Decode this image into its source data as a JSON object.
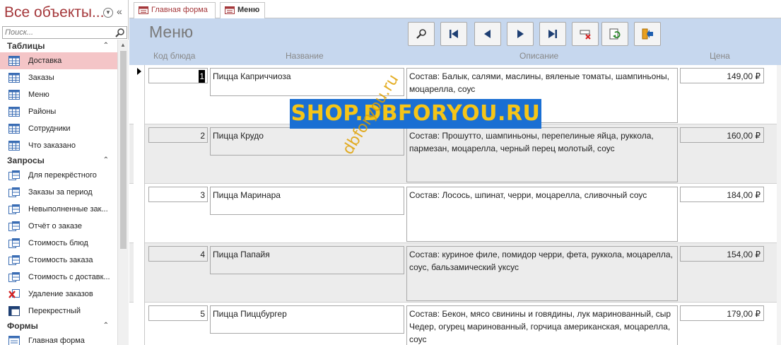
{
  "nav": {
    "title": "Все объекты...",
    "search_placeholder": "Поиск...",
    "groups": [
      {
        "label": "Таблицы",
        "items": [
          {
            "label": "Доставка",
            "icon": "table-icon",
            "selected": true
          },
          {
            "label": "Заказы",
            "icon": "table-icon"
          },
          {
            "label": "Меню",
            "icon": "table-icon"
          },
          {
            "label": "Районы",
            "icon": "table-icon"
          },
          {
            "label": "Сотрудники",
            "icon": "table-icon"
          },
          {
            "label": "Что заказано",
            "icon": "table-icon"
          }
        ]
      },
      {
        "label": "Запросы",
        "items": [
          {
            "label": "Для перекрёстного",
            "icon": "query-icon"
          },
          {
            "label": "Заказы за период",
            "icon": "query-icon"
          },
          {
            "label": "Невыполненные зак...",
            "icon": "query-icon"
          },
          {
            "label": "Отчёт о заказе",
            "icon": "query-icon"
          },
          {
            "label": "Стоимость блюд",
            "icon": "query-icon"
          },
          {
            "label": "Стоимость заказа",
            "icon": "query-icon"
          },
          {
            "label": "Стоимость с доставк...",
            "icon": "query-icon"
          },
          {
            "label": "Удаление заказов",
            "icon": "delete-query-icon"
          },
          {
            "label": "Перекрестный",
            "icon": "crosstab-query-icon"
          }
        ]
      },
      {
        "label": "Формы",
        "items": [
          {
            "label": "Главная форма",
            "icon": "form-icon"
          }
        ]
      }
    ]
  },
  "tabs": [
    {
      "label": "Главная форма",
      "active": false
    },
    {
      "label": "Меню",
      "active": true
    }
  ],
  "form": {
    "title": "Меню",
    "columns": {
      "code": "Код блюда",
      "name": "Название",
      "desc": "Описание",
      "price": "Цена"
    },
    "records": [
      {
        "code": "1",
        "name": "Пицца Каприччиоза",
        "desc": "Состав: Балык, салями, маслины, вяленые томаты, шампиньоны, моцарелла, соус",
        "price": "149,00 ₽"
      },
      {
        "code": "2",
        "name": "Пицца Крудо",
        "desc": "Состав: Прошутто, шампиньоны, перепелиные яйца, руккола, пармезан, моцарелла, черный перец молотый, соус",
        "price": "160,00 ₽"
      },
      {
        "code": "3",
        "name": "Пицца Маринара",
        "desc": "Состав: Лосось, шпинат, черри, моцарелла, сливочный соус",
        "price": "184,00 ₽"
      },
      {
        "code": "4",
        "name": "Пицца Папайя",
        "desc": "Состав: куриное филе, помидор черри, фета, руккола, моцарелла, соус, бальзамический уксус",
        "price": "154,00 ₽"
      },
      {
        "code": "5",
        "name": "Пицца Пиццбургер",
        "desc": "Состав: Бекон, мясо свинины и говядины, лук маринованный, сыр Чедер, огурец маринованный, горчица американская, моцарелла, соус",
        "price": "179,00 ₽"
      }
    ]
  },
  "watermark": {
    "banner": "SHOP.DBFORYOU.RU",
    "diagonal": "dbforyou.ru",
    "banner_bg": "#1a6fd3",
    "banner_fg": "#f5c518"
  },
  "colors": {
    "accent": "#a4373a",
    "header_bg": "#c6d7ee",
    "selected_nav": "#f4c5c7"
  }
}
